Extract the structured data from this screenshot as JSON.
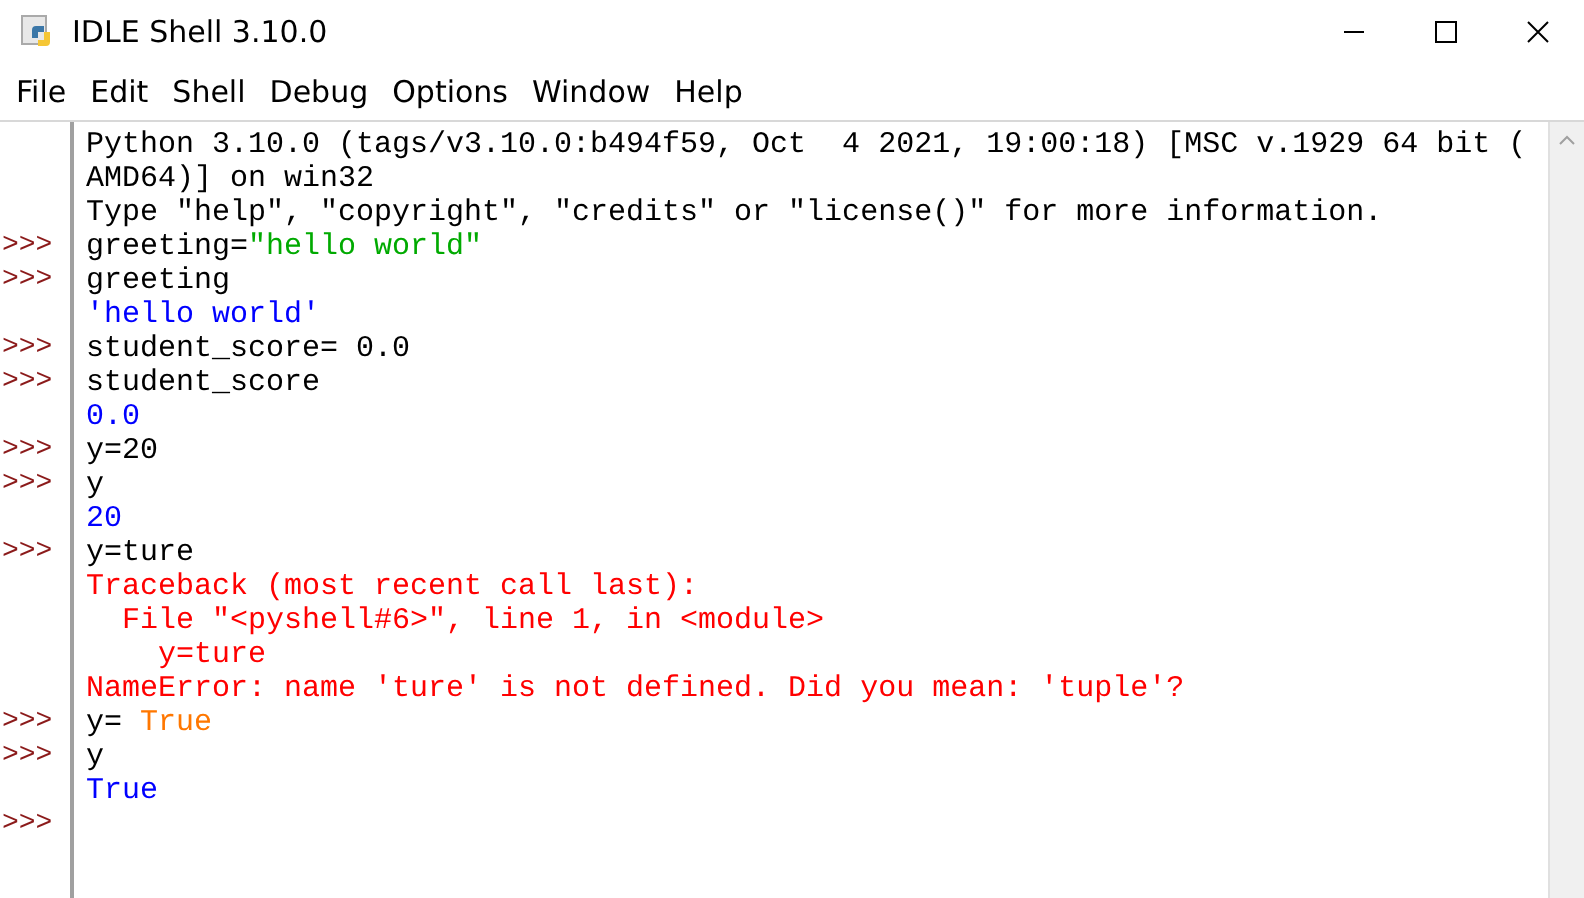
{
  "window": {
    "title": "IDLE Shell 3.10.0"
  },
  "menu": [
    "File",
    "Edit",
    "Shell",
    "Debug",
    "Options",
    "Window",
    "Help"
  ],
  "shell": {
    "lines": [
      {
        "segments": [
          {
            "kind": "plain",
            "text": "Python 3.10.0 (tags/v3.10.0:b494f59, Oct  4 2021, 19:00:18) [MSC v.1929 64 bit ("
          }
        ]
      },
      {
        "segments": [
          {
            "kind": "plain",
            "text": "AMD64)] on win32"
          }
        ]
      },
      {
        "segments": [
          {
            "kind": "plain",
            "text": "Type \"help\", \"copyright\", \"credits\" or \"license()\" for more information."
          }
        ]
      },
      {
        "prompt": ">>>",
        "segments": [
          {
            "kind": "plain",
            "text": "greeting="
          },
          {
            "kind": "string",
            "text": "\"hello world\""
          }
        ]
      },
      {
        "prompt": ">>>",
        "segments": [
          {
            "kind": "plain",
            "text": "greeting"
          }
        ]
      },
      {
        "segments": [
          {
            "kind": "output",
            "text": "'hello world'"
          }
        ]
      },
      {
        "prompt": ">>>",
        "segments": [
          {
            "kind": "plain",
            "text": "student_score= 0.0"
          }
        ]
      },
      {
        "prompt": ">>>",
        "segments": [
          {
            "kind": "plain",
            "text": "student_score"
          }
        ]
      },
      {
        "segments": [
          {
            "kind": "output",
            "text": "0.0"
          }
        ]
      },
      {
        "prompt": ">>>",
        "segments": [
          {
            "kind": "plain",
            "text": "y=20"
          }
        ]
      },
      {
        "prompt": ">>>",
        "segments": [
          {
            "kind": "plain",
            "text": "y"
          }
        ]
      },
      {
        "segments": [
          {
            "kind": "output",
            "text": "20"
          }
        ]
      },
      {
        "prompt": ">>>",
        "segments": [
          {
            "kind": "plain",
            "text": "y=ture"
          }
        ]
      },
      {
        "segments": [
          {
            "kind": "error",
            "text": "Traceback (most recent call last):"
          }
        ]
      },
      {
        "segments": [
          {
            "kind": "error",
            "text": "  File \"<pyshell#6>\", line 1, in <module>"
          }
        ]
      },
      {
        "segments": [
          {
            "kind": "error",
            "text": "    y=ture"
          }
        ]
      },
      {
        "segments": [
          {
            "kind": "error",
            "text": "NameError: name 'ture' is not defined. Did you mean: 'tuple'?"
          }
        ]
      },
      {
        "prompt": ">>>",
        "segments": [
          {
            "kind": "plain",
            "text": "y= "
          },
          {
            "kind": "keyword",
            "text": "True"
          }
        ]
      },
      {
        "prompt": ">>>",
        "segments": [
          {
            "kind": "plain",
            "text": "y"
          }
        ]
      },
      {
        "segments": [
          {
            "kind": "output",
            "text": "True"
          }
        ]
      },
      {
        "prompt": ">>>"
      }
    ]
  }
}
